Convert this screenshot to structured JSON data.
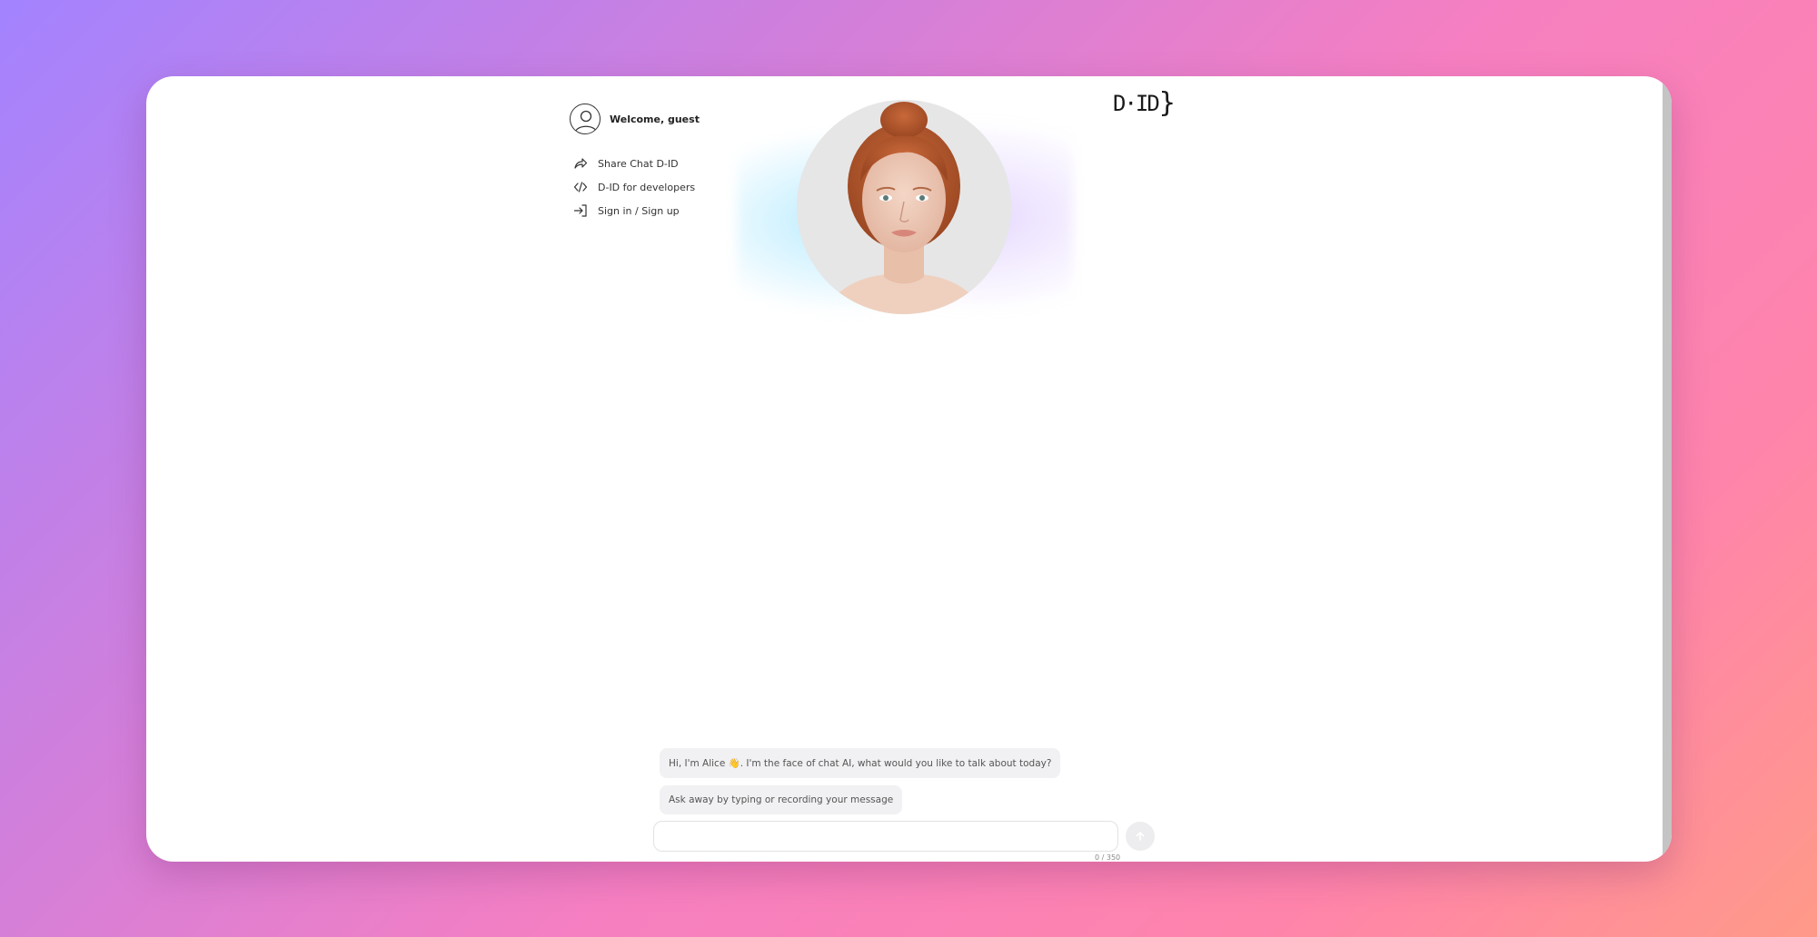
{
  "sidebar": {
    "welcome": "Welcome, guest",
    "items": [
      {
        "label": "Share Chat D-ID",
        "icon": "share-icon"
      },
      {
        "label": "D-ID for developers",
        "icon": "code-icon"
      },
      {
        "label": "Sign in / Sign up",
        "icon": "sign-in-icon"
      }
    ]
  },
  "logo": {
    "text": "D·ID",
    "brace": "}"
  },
  "chat": {
    "messages": [
      "Hi, I'm Alice 👋. I'm the face of chat AI, what would you like to talk about today?",
      "Ask away by typing or recording your message"
    ],
    "input_value": "",
    "input_placeholder": "",
    "counter": "0 / 350"
  },
  "colors": {
    "accent_glow_left": "#82dcff",
    "accent_glow_right": "#c8aaff"
  }
}
